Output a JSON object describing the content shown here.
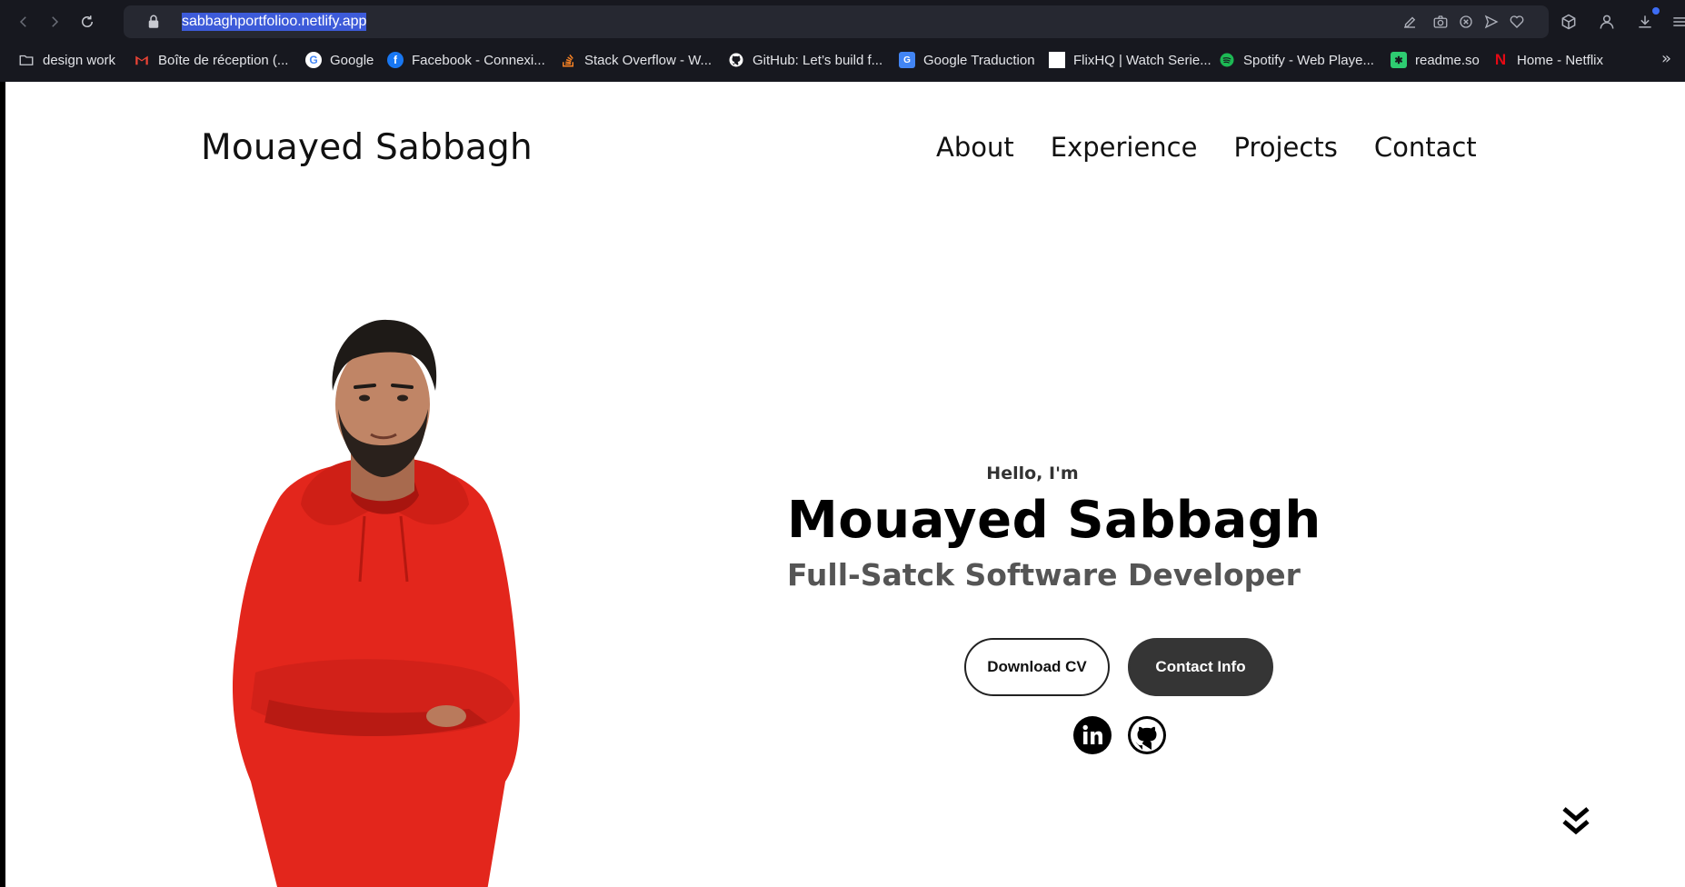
{
  "browser": {
    "url": "sabbaghportfolioo.netlify.app",
    "bookmarks": [
      {
        "label": "design work",
        "icon": "folder-icon",
        "color": "#c9cbd2"
      },
      {
        "label": "Boîte de réception (...",
        "icon": "gmail-icon",
        "color": "#ea4335"
      },
      {
        "label": "Google",
        "icon": "google-icon",
        "color": "#4285f4"
      },
      {
        "label": "Facebook - Connexi...",
        "icon": "facebook-icon",
        "color": "#1877f2"
      },
      {
        "label": "Stack Overflow - W...",
        "icon": "stackoverflow-icon",
        "color": "#f48024"
      },
      {
        "label": "GitHub: Let’s build f...",
        "icon": "github-icon",
        "color": "#ffffff"
      },
      {
        "label": "Google Traduction",
        "icon": "google-translate-icon",
        "color": "#4285f4"
      },
      {
        "label": "FlixHQ | Watch Serie...",
        "icon": "flixhq-icon",
        "color": "#ffffff"
      },
      {
        "label": "Spotify - Web Playe...",
        "icon": "spotify-icon",
        "color": "#1db954"
      },
      {
        "label": "readme.so",
        "icon": "readme-icon",
        "color": "#2ecc71"
      },
      {
        "label": "Home - Netflix",
        "icon": "netflix-icon",
        "color": "#e50914"
      }
    ]
  },
  "site": {
    "logo": "Mouayed Sabbagh",
    "nav": [
      "About",
      "Experience",
      "Projects",
      "Contact"
    ],
    "hero": {
      "greeting": "Hello, I'm",
      "name": "Mouayed Sabbagh",
      "title": "Full-Satck Software Developer",
      "buttons": {
        "download_cv": "Download CV",
        "contact_info": "Contact Info"
      }
    }
  },
  "colors": {
    "accent_dark": "#353535",
    "hoodie_red": "#e3261c",
    "chrome_bg": "#17181f",
    "url_highlight": "#3d5bd9"
  }
}
